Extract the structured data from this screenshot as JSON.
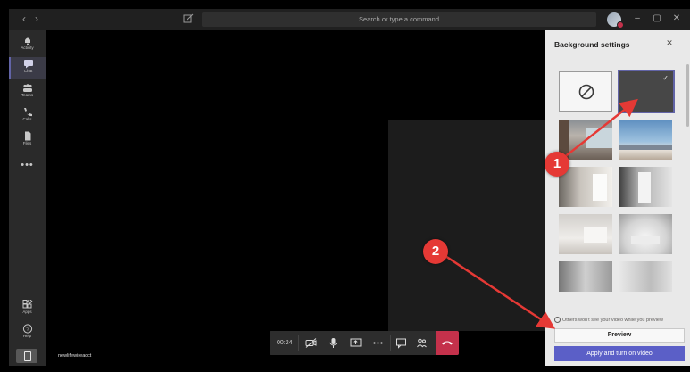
{
  "search": {
    "placeholder": "Search or type a command"
  },
  "rail": {
    "items": [
      {
        "label": "Activity"
      },
      {
        "label": "Chat"
      },
      {
        "label": "Teams"
      },
      {
        "label": "Calls"
      },
      {
        "label": "Files"
      }
    ],
    "more": "•••",
    "apps": "Apps",
    "help": "Help"
  },
  "call": {
    "timer": "00:24",
    "participant_name": "newlifewireacct"
  },
  "background_panel": {
    "title": "Background settings",
    "note": "Others won't see your video while you preview",
    "preview_label": "Preview",
    "apply_label": "Apply and turn on video",
    "selected": "blur"
  },
  "annotations": {
    "step1": "1",
    "step2": "2"
  },
  "colors": {
    "accent": "#6264a7",
    "marker": "#e53935",
    "hangup": "#c4314b"
  }
}
